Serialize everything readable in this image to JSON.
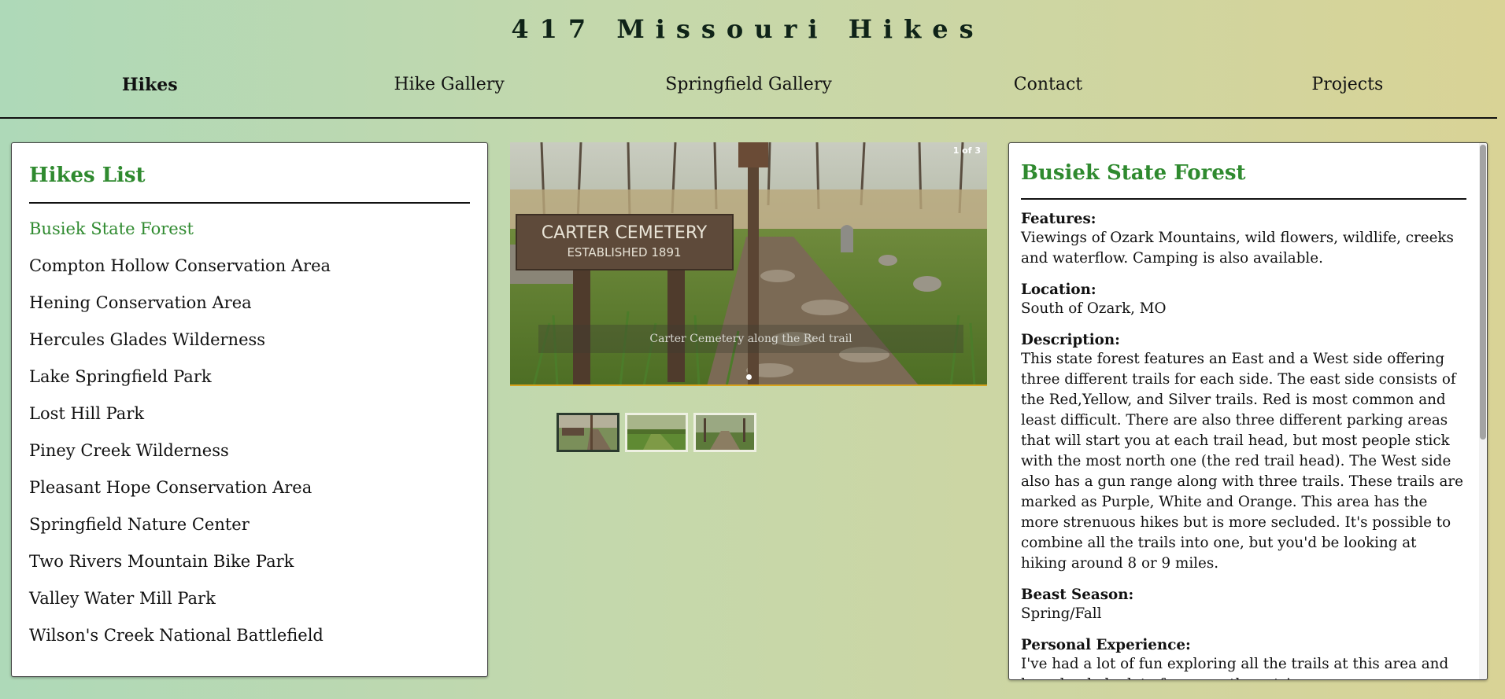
{
  "site": {
    "title": "417 Missouri Hikes"
  },
  "nav": {
    "items": [
      {
        "label": "Hikes"
      },
      {
        "label": "Hike Gallery"
      },
      {
        "label": "Springfield Gallery"
      },
      {
        "label": "Contact"
      },
      {
        "label": "Projects"
      }
    ],
    "active": "Hikes"
  },
  "hikes_list": {
    "title": "Hikes List",
    "items": [
      "Busiek State Forest",
      "Compton Hollow Conservation Area",
      "Hening Conservation Area",
      "Hercules Glades Wilderness",
      "Lake Springfield Park",
      "Lost Hill Park",
      "Piney Creek Wilderness",
      "Pleasant Hope Conservation Area",
      "Springfield Nature Center",
      "Two Rivers Mountain Bike Park",
      "Valley Water Mill Park",
      "Wilson's Creek National Battlefield"
    ],
    "selected": "Busiek State Forest"
  },
  "carousel": {
    "counter": "1 of 3",
    "caption": "Carter Cemetery along the Red trail",
    "sign_line1": "CARTER CEMETERY",
    "sign_line2": "ESTABLISHED 1891",
    "thumbnail_count": 3,
    "active_index": 0
  },
  "detail": {
    "title": "Busiek State Forest",
    "features_label": "Features:",
    "features": "Viewings of Ozark Mountains, wild flowers, wildlife, creeks and waterflow. Camping is also available.",
    "location_label": "Location:",
    "location": "South of Ozark, MO",
    "description_label": "Description:",
    "description": "This state forest features an East and a West side offering three different trails for each side. The east side consists of the Red,Yellow, and Silver trails. Red is most common and least difficult. There are also three different parking areas that will start you at each trail head, but most people stick with the most north one (the red trail head). The West side also has a gun range along with three trails. These trails are marked as Purple, White and Orange. This area has the more strenuous hikes but is more secluded. It's possible to combine all the trails into one, but you'd be looking at hiking around 8 or 9 miles.",
    "season_label": "Beast Season:",
    "season": "Spring/Fall",
    "experience_label": "Personal Experience:",
    "experience": "I've had a lot of fun exploring all the trails at this area and have hauled a lot of gear on these trips."
  },
  "colors": {
    "accent_green": "#2f8a2f",
    "carousel_border": "#d8a31c"
  }
}
